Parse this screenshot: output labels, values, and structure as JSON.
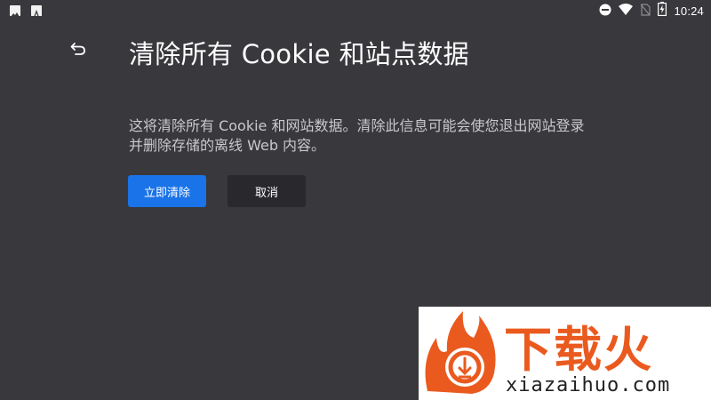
{
  "status_bar": {
    "time": "10:24",
    "left_icons": [
      "image-notification-icon",
      "font-notification-icon"
    ],
    "right_icons": [
      "do-not-disturb-icon",
      "wifi-icon",
      "no-sim-icon",
      "battery-charging-icon"
    ]
  },
  "header": {
    "back_icon": "back-arrow-icon",
    "title": "清除所有 Cookie 和站点数据"
  },
  "dialog": {
    "description": "这将清除所有 Cookie 和网站数据。清除此信息可能会使您退出网站登录并删除存储的离线 Web 内容。",
    "confirm_label": "立即清除",
    "cancel_label": "取消"
  },
  "watermark": {
    "brand": "下载火",
    "url": "xiazaihuo.com"
  },
  "colors": {
    "background": "#39383c",
    "primary_button": "#1a73e8",
    "secondary_button": "#29282c",
    "watermark_accent": "#ea5a1f"
  }
}
